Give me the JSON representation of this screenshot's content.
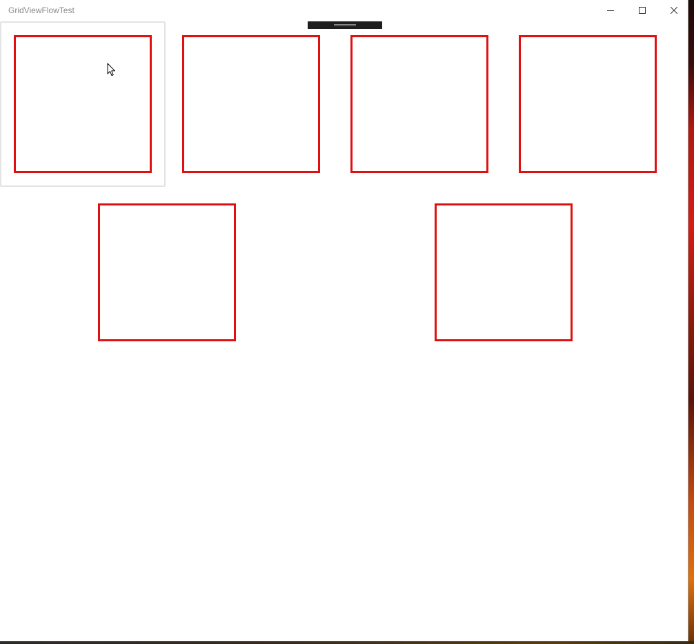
{
  "window": {
    "title": "GridViewFlowTest"
  },
  "caption_buttons": {
    "minimize_icon": "minimize-icon",
    "maximize_icon": "maximize-icon",
    "close_icon": "close-icon"
  },
  "grid": {
    "item_count": 6,
    "item_border_color": "#e01010",
    "focus_border_color": "#e3e3e3"
  },
  "colors": {
    "window_bg": "#ffffff",
    "title_text": "#8a8a8a",
    "drag_handle": "#1e1e1e"
  }
}
